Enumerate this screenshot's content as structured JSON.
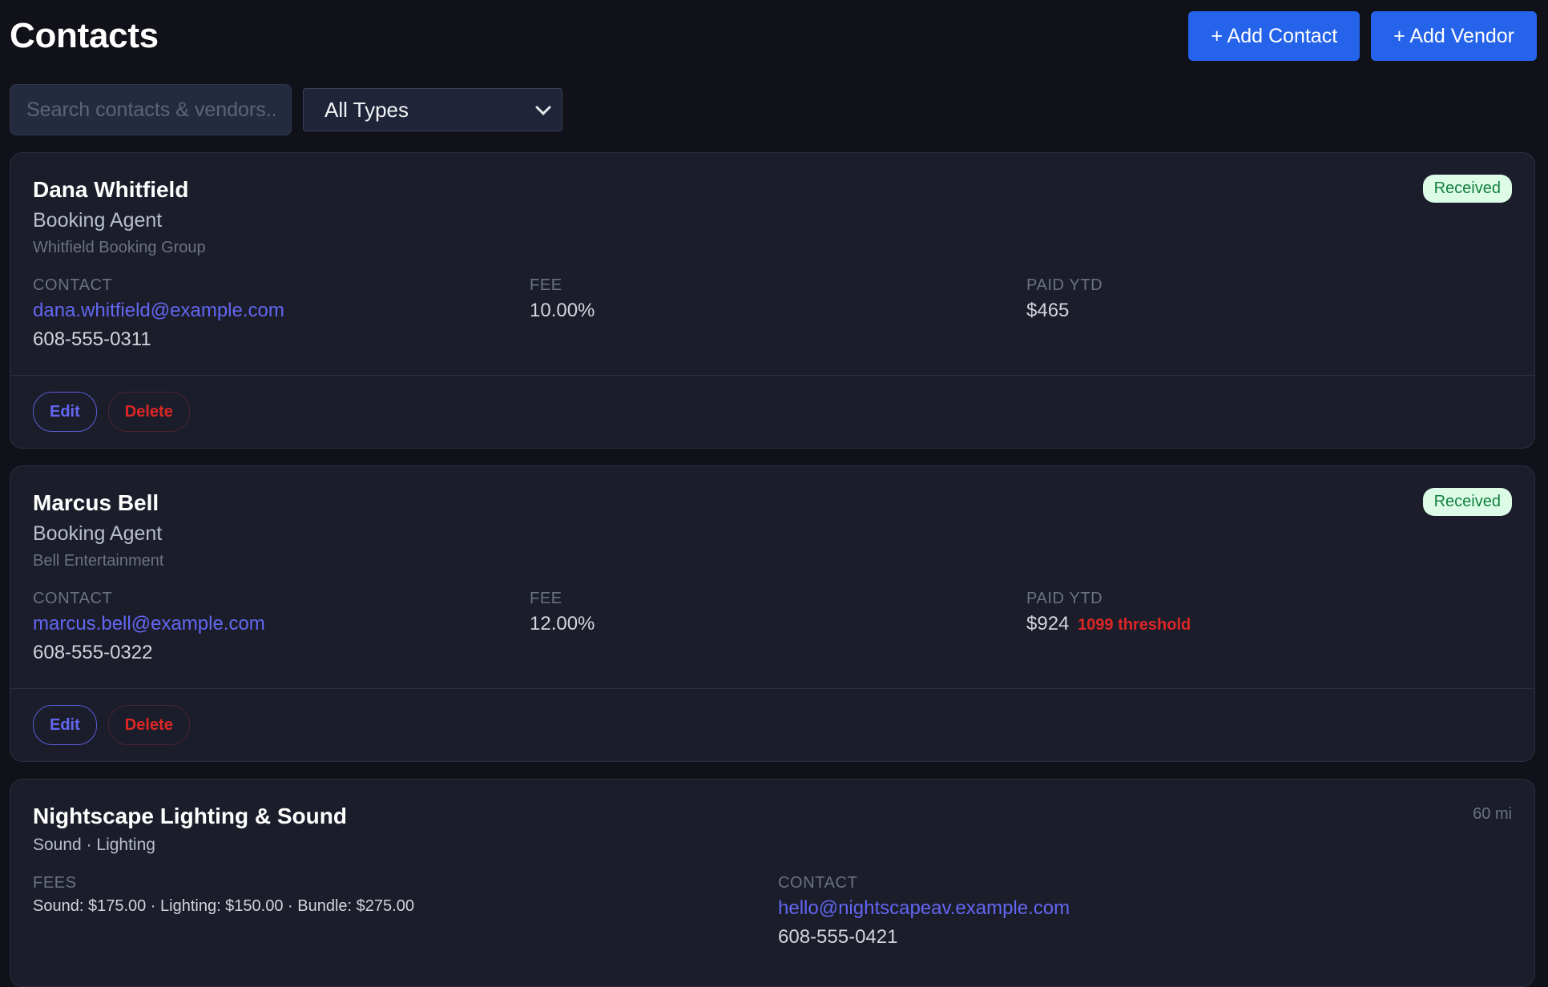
{
  "header": {
    "title": "Contacts",
    "add_contact_label": "+ Add Contact",
    "add_vendor_label": "+ Add Vendor"
  },
  "filters": {
    "search_placeholder": "Search contacts & vendors..",
    "search_value": "",
    "type_selected": "All Types"
  },
  "labels": {
    "contact": "CONTACT",
    "fee": "FEE",
    "paid_ytd": "PAID YTD",
    "fees": "FEES",
    "edit": "Edit",
    "delete": "Delete"
  },
  "contacts": [
    {
      "name": "Dana Whitfield",
      "role": "Booking Agent",
      "company": "Whitfield Booking Group",
      "status": "Received",
      "email": "dana.whitfield@example.com",
      "phone": "608-555-0311",
      "fee": "10.00%",
      "paid_ytd": "$465",
      "note": ""
    },
    {
      "name": "Marcus Bell",
      "role": "Booking Agent",
      "company": "Bell Entertainment",
      "status": "Received",
      "email": "marcus.bell@example.com",
      "phone": "608-555-0322",
      "fee": "12.00%",
      "paid_ytd": "$924",
      "note": "1099 threshold"
    }
  ],
  "vendors": [
    {
      "name": "Nightscape Lighting & Sound",
      "categories": "Sound · Lighting",
      "distance": "60 mi",
      "fees": "Sound: $175.00 · Lighting: $150.00 · Bundle: $275.00",
      "email": "hello@nightscapeav.example.com",
      "phone": "608-555-0421"
    }
  ],
  "colors": {
    "background": "#101119",
    "card": "#1b1e2a",
    "accent": "#2563eb",
    "link": "#6366f1",
    "danger": "#dc2626",
    "success_bg": "#dcfce7",
    "success_text": "#15803d"
  }
}
